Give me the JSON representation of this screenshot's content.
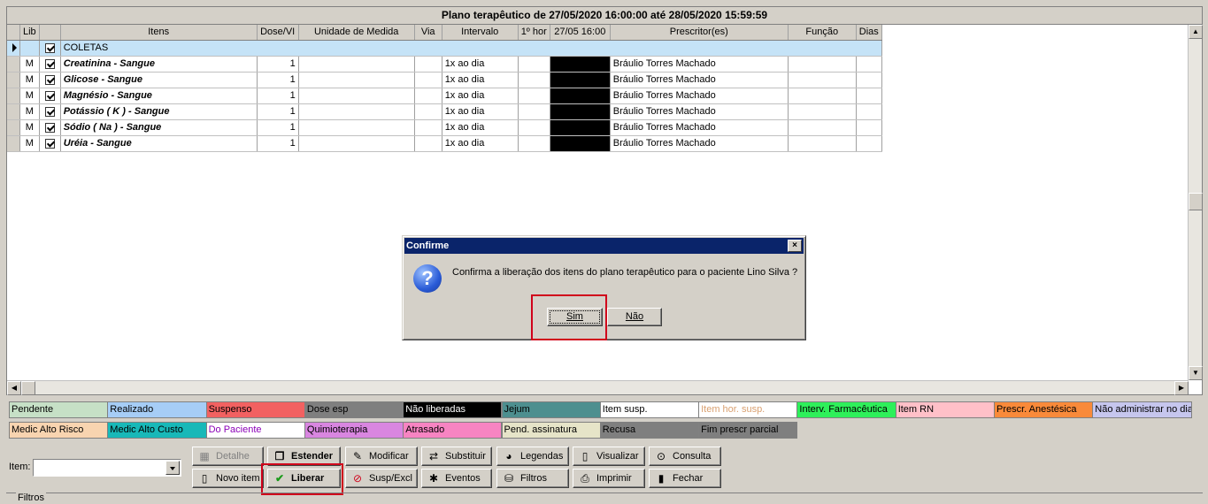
{
  "title": "Plano terapêutico de 27/05/2020 16:00:00 até 28/05/2020 15:59:59",
  "columns": [
    "Lib",
    "Itens",
    "Dose/VI",
    "Unidade de Medida",
    "Via",
    "Intervalo",
    "1º hor",
    "27/05 16:00",
    "Prescritor(es)",
    "Função",
    "Dias"
  ],
  "group_label": "COLETAS",
  "rows": [
    {
      "lib": "M",
      "item": "Creatinina - Sangue",
      "dose": "1",
      "intervalo": "1x ao dia",
      "prescritor": "Bráulio Torres Machado"
    },
    {
      "lib": "M",
      "item": "Glicose - Sangue",
      "dose": "1",
      "intervalo": "1x ao dia",
      "prescritor": "Bráulio Torres Machado"
    },
    {
      "lib": "M",
      "item": "Magnésio - Sangue",
      "dose": "1",
      "intervalo": "1x ao dia",
      "prescritor": "Bráulio Torres Machado"
    },
    {
      "lib": "M",
      "item": "Potássio ( K ) - Sangue",
      "dose": "1",
      "intervalo": "1x ao dia",
      "prescritor": "Bráulio Torres Machado"
    },
    {
      "lib": "M",
      "item": "Sódio ( Na ) - Sangue",
      "dose": "1",
      "intervalo": "1x ao dia",
      "prescritor": "Bráulio Torres Machado"
    },
    {
      "lib": "M",
      "item": "Uréia - Sangue",
      "dose": "1",
      "intervalo": "1x ao dia",
      "prescritor": "Bráulio Torres Machado"
    }
  ],
  "dialog": {
    "title": "Confirme",
    "close": "×",
    "message": "Confirma a liberação dos itens do plano terapêutico para o paciente Lino Silva ?",
    "icon": "?",
    "yes": "Sim",
    "no": "Não"
  },
  "legend_row1": [
    {
      "label": "Pendente",
      "color": "#c6e0c6"
    },
    {
      "label": "Realizado",
      "color": "#a6cdf6"
    },
    {
      "label": "Suspenso",
      "color": "#f26161"
    },
    {
      "label": "Dose esp",
      "color": "#7f7f7f"
    },
    {
      "label": "Não liberadas",
      "color": "#000000",
      "text": "#ffffff"
    },
    {
      "label": "Jejum",
      "color": "#4d8f8f"
    },
    {
      "label": "Item susp.",
      "color": "#ffffff"
    },
    {
      "label": "Item hor. susp.",
      "color": "#ffffff",
      "text": "#d9a070"
    },
    {
      "label": "Interv. Farmacêutica",
      "color": "#2ef05a"
    },
    {
      "label": "Item RN",
      "color": "#ffc0c8"
    },
    {
      "label": "Prescr. Anestésica",
      "color": "#f98a3a"
    },
    {
      "label": "Não administrar no dia",
      "color": "#c6c6ee"
    }
  ],
  "legend_row2": [
    {
      "label": "Medic Alto Risco",
      "color": "#f8d4b0"
    },
    {
      "label": "Medic Alto Custo",
      "color": "#18b8b8"
    },
    {
      "label": "Do Paciente",
      "color": "#ffffff",
      "text": "#8b00b8"
    },
    {
      "label": "Quimioterapia",
      "color": "#d986e0"
    },
    {
      "label": "Atrasado",
      "color": "#f784c2"
    },
    {
      "label": "Pend. assinatura",
      "color": "#e6e4c8"
    },
    {
      "label": "Recusa",
      "color": "#7f7f7f"
    },
    {
      "label": "Fim prescr parcial",
      "color": "#7f7f7f"
    }
  ],
  "item_label": "Item:",
  "toolbar_row1": [
    {
      "label": "Detalhe",
      "icon": "table-icon",
      "glyph": "▦",
      "disabled": true
    },
    {
      "label": "Estender",
      "icon": "copy-icon",
      "glyph": "❐",
      "bold": true
    },
    {
      "label": "Modificar",
      "icon": "edit-icon",
      "glyph": "✎"
    },
    {
      "label": "Substituir",
      "icon": "replace-icon",
      "glyph": "⇄"
    },
    {
      "label": "Legendas",
      "icon": "palette-icon",
      "glyph": "◕"
    },
    {
      "label": "Visualizar",
      "icon": "document-icon",
      "glyph": "▯"
    },
    {
      "label": "Consulta",
      "icon": "binoculars-icon",
      "glyph": "⊙"
    }
  ],
  "toolbar_row2": [
    {
      "label": "Novo item",
      "icon": "new-document-icon",
      "glyph": "▯"
    },
    {
      "label": "Liberar",
      "icon": "check-icon",
      "glyph": "✔",
      "bold": true
    },
    {
      "label": "Susp/Excl",
      "icon": "prohibited-icon",
      "glyph": "⊘"
    },
    {
      "label": "Eventos",
      "icon": "events-icon",
      "glyph": "✱"
    },
    {
      "label": "Filtros",
      "icon": "filter-icon",
      "glyph": "⛁"
    },
    {
      "label": "Imprimir",
      "icon": "printer-icon",
      "glyph": "⎙"
    },
    {
      "label": "Fechar",
      "icon": "door-icon",
      "glyph": "▮"
    }
  ],
  "filters_label": "Filtros"
}
